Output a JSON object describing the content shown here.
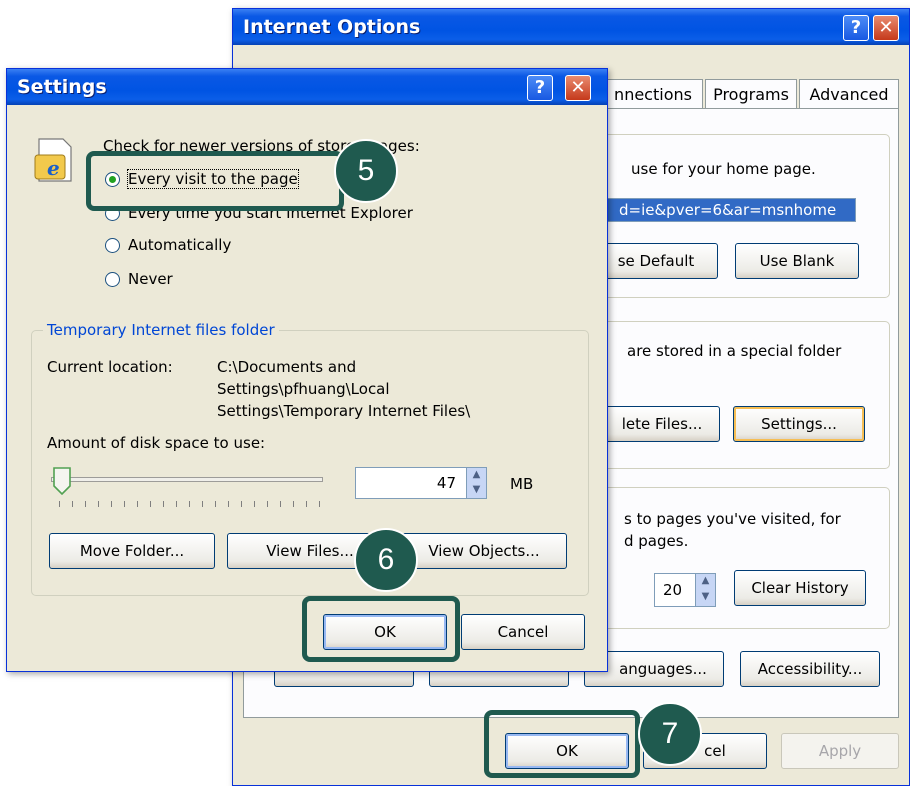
{
  "internet_options": {
    "title": "Internet Options",
    "tabs": [
      "Connections",
      "Programs",
      "Advanced"
    ],
    "tab_connections_visible": "nnections",
    "home_page_text": "use for your home page.",
    "address_value": "d=ie&pver=6&ar=msnhome",
    "use_default_label": "se Default",
    "use_blank_label": "Use Blank",
    "temp_files_text": "are stored in a special folder",
    "delete_files_label": "lete Files...",
    "settings_label": "Settings...",
    "history_text_1": "s to pages you've visited, for",
    "history_text_2": "d pages.",
    "history_days": "20",
    "clear_history_label": "Clear History",
    "languages_label": "anguages...",
    "accessibility_label": "Accessibility...",
    "ok_label": "OK",
    "cancel_label": "cel",
    "apply_label": "Apply"
  },
  "settings": {
    "title": "Settings",
    "check_label": "Check for newer versions of stored pages:",
    "check_label_visible_end": "d pages:",
    "radio_every_visit": "Every visit to the page",
    "radio_every_start": "Every time you start Internet Explorer",
    "radio_automatically": "Automatically",
    "radio_never": "Never",
    "selected_option": "Every visit to the page",
    "temp_folder_group": "Temporary Internet files folder",
    "current_location_label": "Current location:",
    "current_location_line1": "C:\\Documents and",
    "current_location_line2": "Settings\\pfhuang\\Local",
    "current_location_line3": "Settings\\Temporary Internet Files\\",
    "disk_space_label": "Amount of disk space to use:",
    "disk_space_value": "47",
    "disk_space_unit": "MB",
    "disk_slider_fraction": 0.02,
    "move_folder_label": "Move Folder...",
    "view_files_label": "View Files...",
    "view_objects_label": "View Objects...",
    "ok_label": "OK",
    "cancel_label": "Cancel"
  },
  "callouts": {
    "step5": "5",
    "step6": "6",
    "step7": "7",
    "color": "#1F5A4F"
  }
}
